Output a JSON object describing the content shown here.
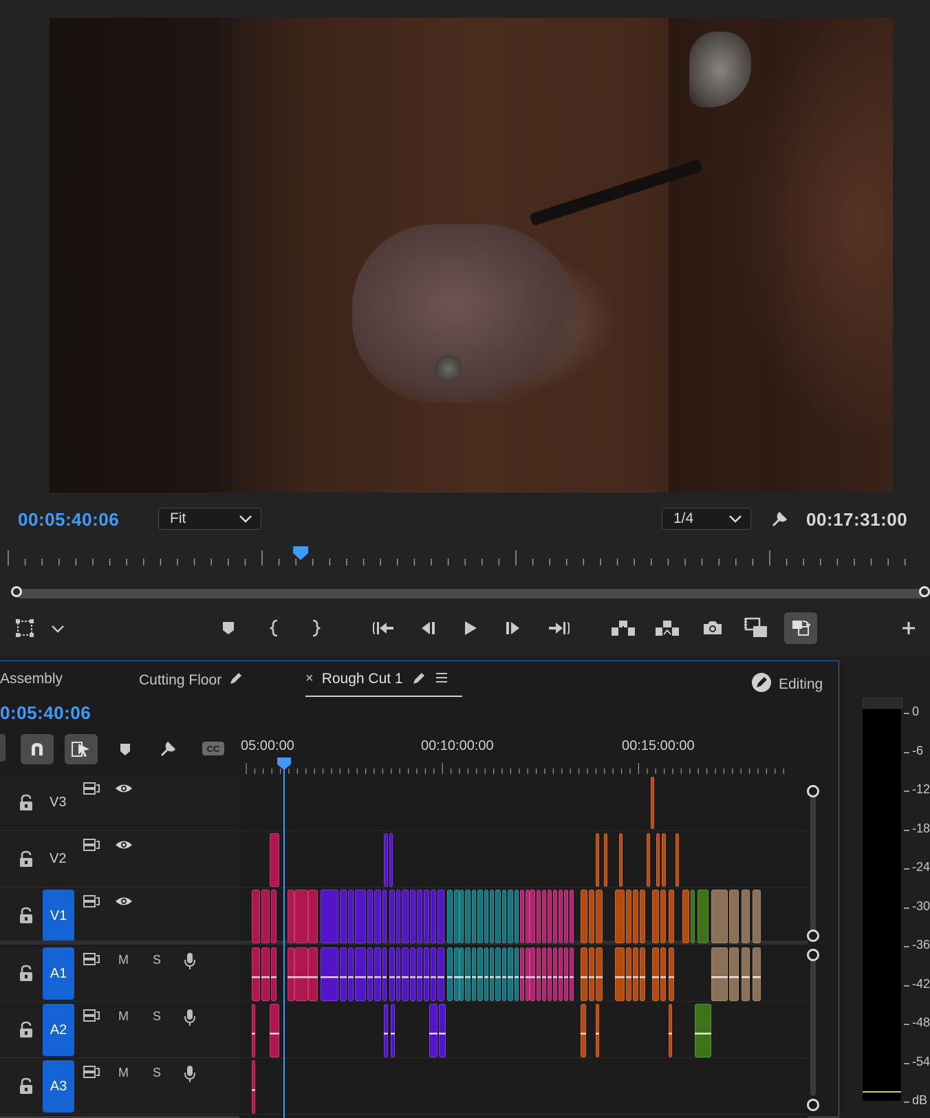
{
  "monitor": {
    "playhead_timecode": "00:05:40:06",
    "zoom": {
      "selected": "Fit"
    },
    "resolution": {
      "selected": "1/4"
    },
    "duration_timecode": "00:17:31:00",
    "playhead_fraction": 0.327
  },
  "timeline": {
    "tabs": [
      {
        "label": "Assembly"
      },
      {
        "label": "Cutting Floor"
      },
      {
        "label": "Rough Cut 1"
      }
    ],
    "active_tab": "Rough Cut 1",
    "workspace_label": "Editing",
    "playhead_timecode": "0:05:40:06",
    "ruler_labels": [
      "05:00:00",
      "00:10:00:00",
      "00:15:00:00"
    ],
    "tracks": [
      {
        "name": "V3",
        "kind": "video"
      },
      {
        "name": "V2",
        "kind": "video"
      },
      {
        "name": "V1",
        "kind": "video",
        "targeted": true
      },
      {
        "name": "A1",
        "kind": "audio",
        "targeted": true
      },
      {
        "name": "A2",
        "kind": "audio",
        "targeted": true
      },
      {
        "name": "A3",
        "kind": "audio",
        "targeted": true
      }
    ],
    "mute_label": "M",
    "solo_label": "S",
    "clip_colors": {
      "red": "#b0174f",
      "violet": "#5216c8",
      "teal": "#13767e",
      "magenta": "#b2226f",
      "orange": "#b44c12",
      "green": "#3d7418",
      "tan": "#8a7158"
    }
  },
  "audio_meter": {
    "scale": [
      "0",
      "-6",
      "-12",
      "-18",
      "-24",
      "-30",
      "-36",
      "-42",
      "-48",
      "-54",
      "dB"
    ]
  }
}
